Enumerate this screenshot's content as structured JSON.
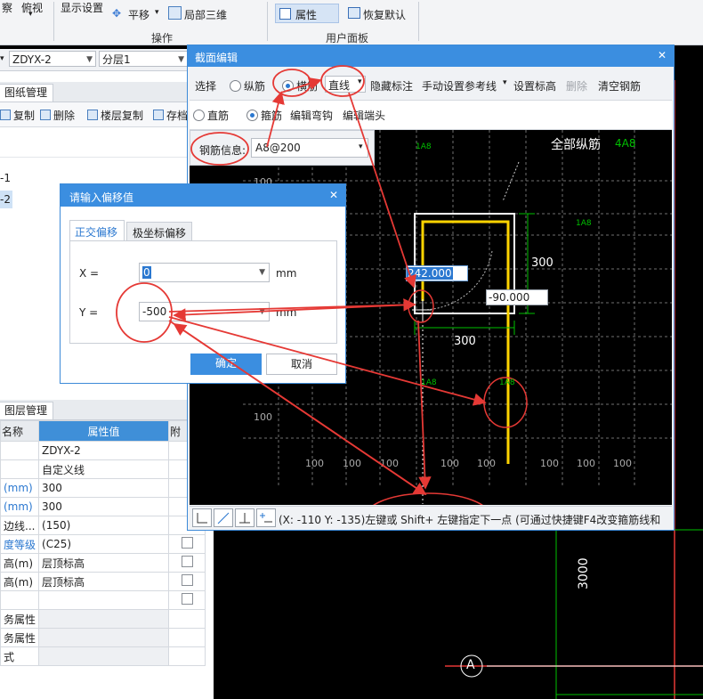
{
  "ribbon": {
    "item_cha": "察",
    "item_fushi": "俯视",
    "item_xianshi": "显示设置",
    "item_pingyi": "平移",
    "item_jubu": "局部三维",
    "group_caozuo": "操作",
    "item_shuxing": "属性",
    "item_huifu": "恢复默认",
    "group_user": "用户面板"
  },
  "selects": {
    "component": "ZDYX-2",
    "floor": "分层1"
  },
  "drawing_panel": {
    "title": "图纸管理",
    "tool_copy": "复制",
    "tool_delete": "删除",
    "tool_floor_copy": "楼层复制",
    "tool_save": "存档",
    "tree_item1": "-1",
    "tree_item2": "-2"
  },
  "layer_panel": {
    "title": "图层管理"
  },
  "prop_table": {
    "col_name": "名称",
    "col_value": "属性值",
    "col_attach": "附",
    "rows": [
      {
        "name": "",
        "value": "ZDYX-2",
        "check": false
      },
      {
        "name": "",
        "value": "自定义线",
        "check": false
      },
      {
        "name": "(mm)",
        "value": "300",
        "check": false
      },
      {
        "name": "(mm)",
        "value": "300",
        "check": false
      },
      {
        "name": "边线...",
        "value": "(150)",
        "check": false
      },
      {
        "name": "度等级",
        "value": "(C25)",
        "check": true
      },
      {
        "name": "高(m)",
        "value": "层顶标高",
        "check": true
      },
      {
        "name": "高(m)",
        "value": "层顶标高",
        "check": true
      },
      {
        "name": "",
        "value": "",
        "check": true
      },
      {
        "name": "务属性",
        "value": "",
        "check": false
      },
      {
        "name": "务属性",
        "value": "",
        "check": false
      },
      {
        "name": "式",
        "value": "",
        "check": false
      }
    ]
  },
  "section_dialog": {
    "title": "截面编辑",
    "close": "✕",
    "tool_select": "选择",
    "radio_long": "纵筋",
    "radio_trans": "横筋",
    "dropdown_line": "直线",
    "tool_hide": "隐藏标注",
    "tool_manual": "手动设置参考线",
    "tool_elev": "设置标高",
    "tool_delete": "删除",
    "tool_clear": "清空钢筋",
    "radio_straight": "直筋",
    "radio_stirrup": "箍筋",
    "tool_bend": "编辑弯钩",
    "tool_end": "编辑端头",
    "rebar_label": "钢筋信息:",
    "rebar_value": "A8@200",
    "all_long_label": "全部纵筋",
    "all_long_value": "4A8",
    "dim_top_left": "1A8",
    "dim_right": "1A8",
    "dim_bottom": "1A8",
    "dim_300_right": "300",
    "dim_300_bottom": "300",
    "input_x": "242.000",
    "input_y": "-90.000",
    "grid_100": "100",
    "status": "(X: -110 Y: -135)左键或 Shift+ 左键指定下一点 (可通过快捷键F4改变箍筋线和"
  },
  "offset_dialog": {
    "title": "请输入偏移值",
    "close": "✕",
    "tab_ortho": "正交偏移",
    "tab_polar": "极坐标偏移",
    "x_label": "X =",
    "x_value": "0",
    "x_unit": "mm",
    "y_label": "Y =",
    "y_value": "-500",
    "y_unit": "mm",
    "ok": "确定",
    "cancel": "取消"
  },
  "bg_canvas": {
    "dim_3000": "3000",
    "axis_a": "A"
  },
  "colors": {
    "accent": "#3b8ee0",
    "rebar_yellow": "#ffd400",
    "grid_green": "#00c000",
    "annotation_red": "#e53935"
  }
}
